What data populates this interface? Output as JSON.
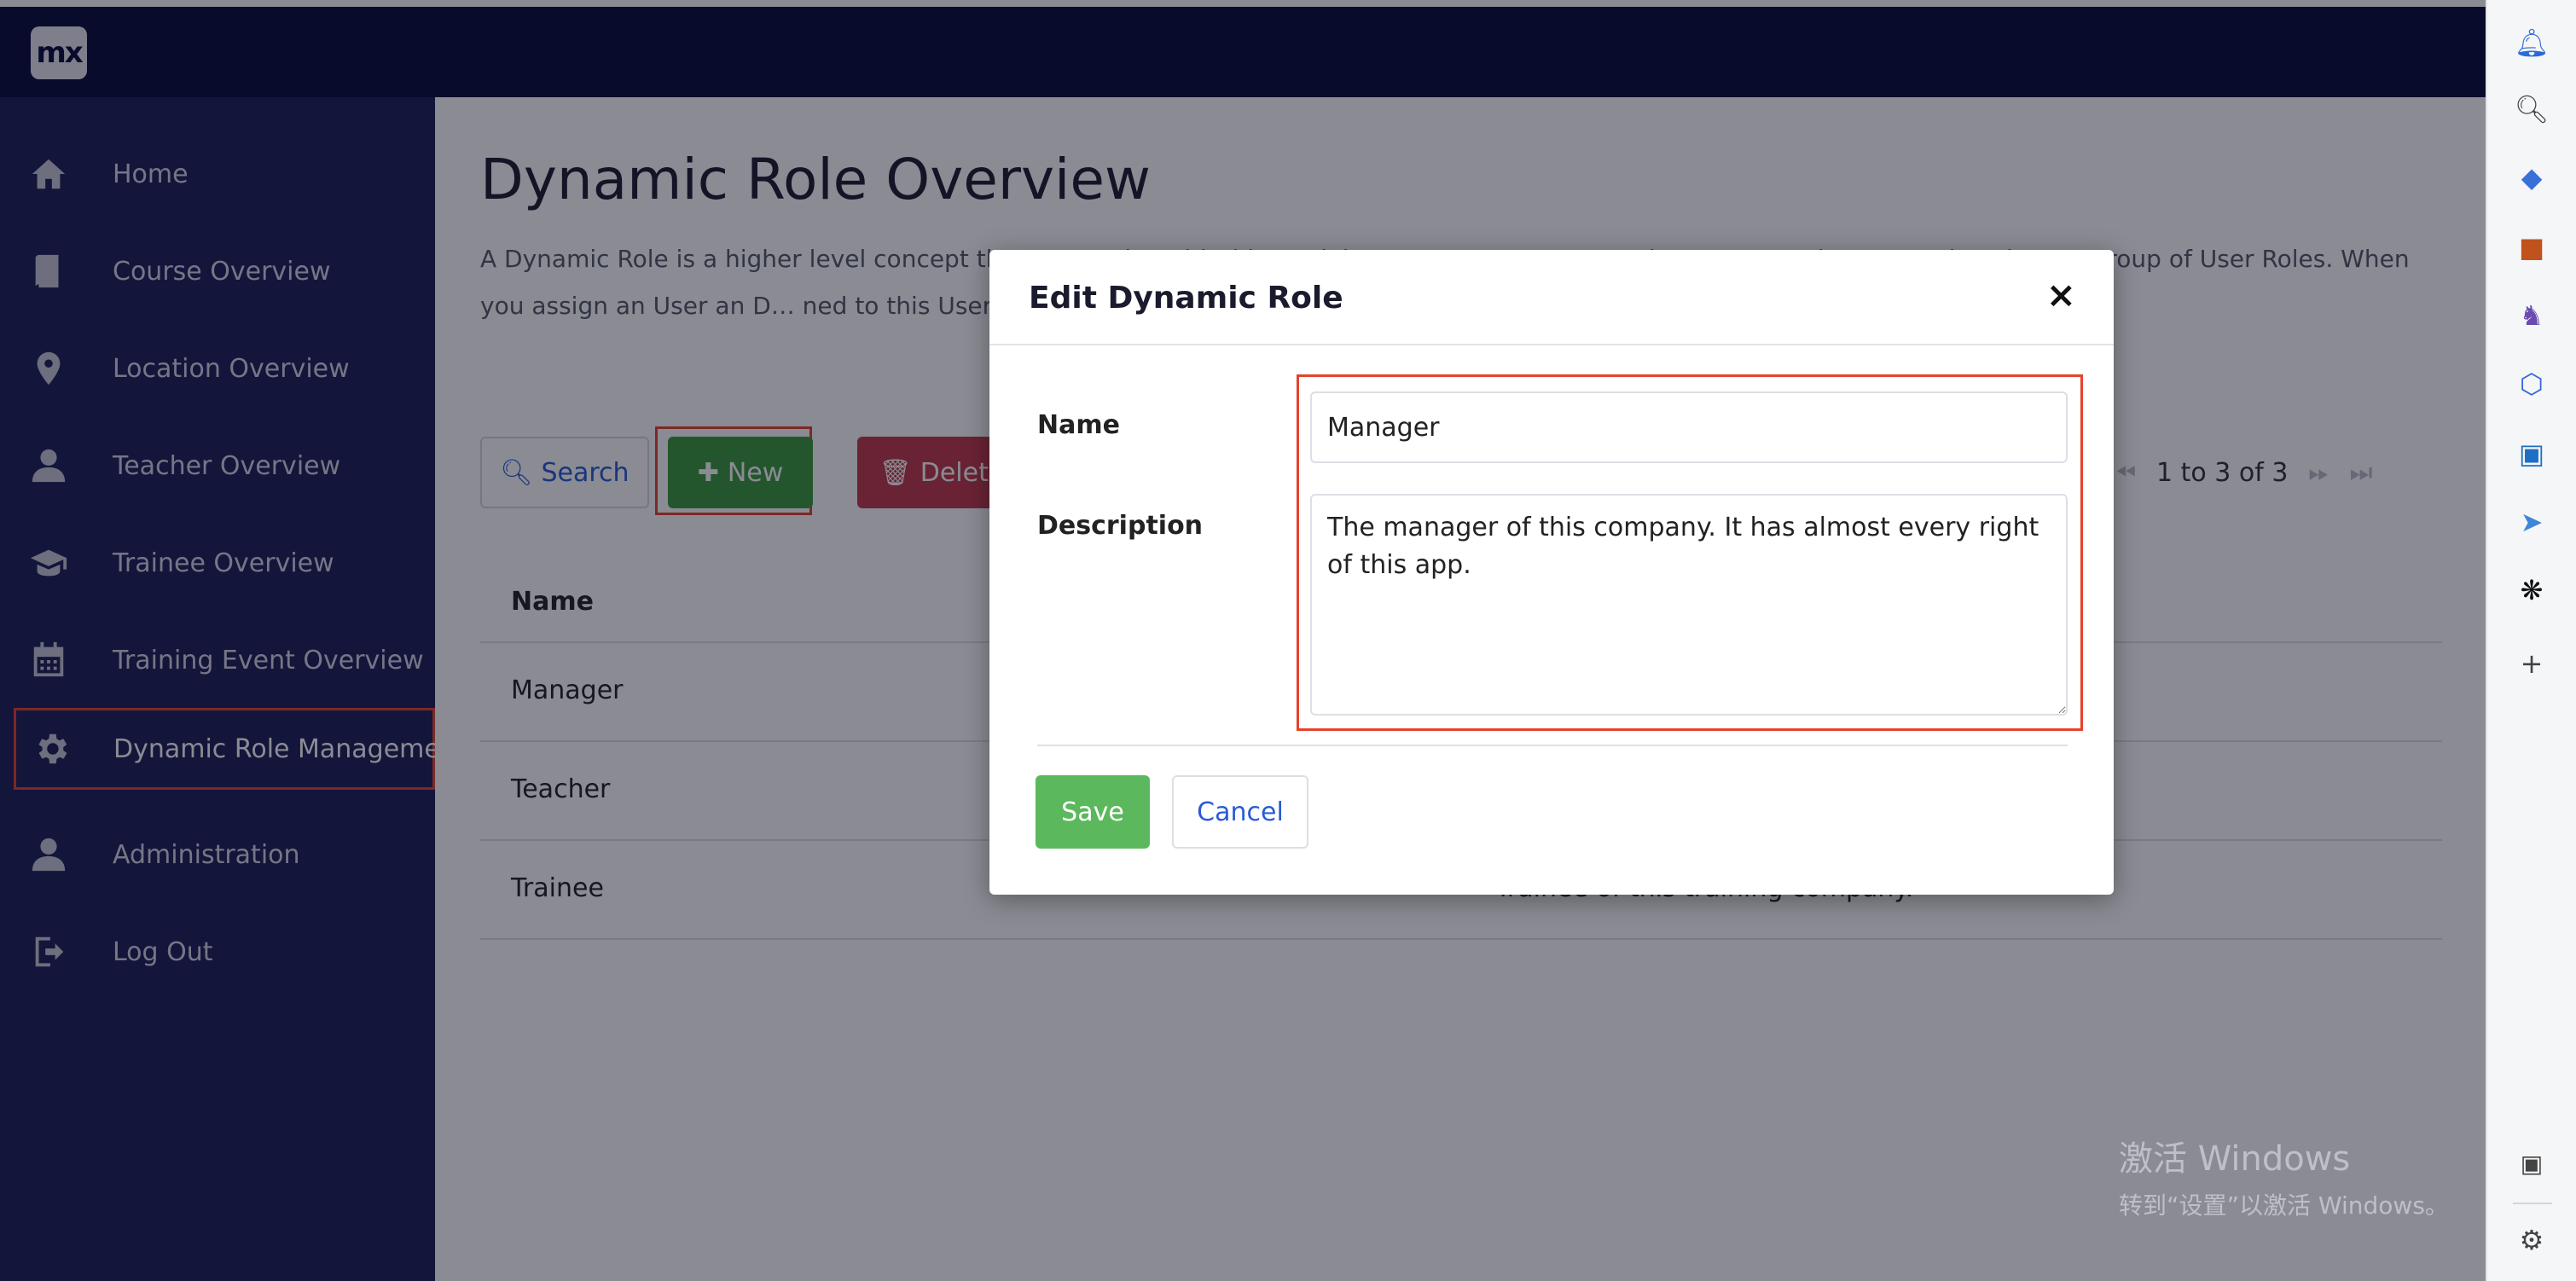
{
  "app": {
    "logo_text": "mx"
  },
  "sidebar": {
    "items": [
      {
        "label": "Home",
        "icon": "home-icon"
      },
      {
        "label": "Course Overview",
        "icon": "book-icon"
      },
      {
        "label": "Location Overview",
        "icon": "map-pin-icon"
      },
      {
        "label": "Teacher Overview",
        "icon": "user-icon"
      },
      {
        "label": "Trainee Overview",
        "icon": "graduation-cap-icon"
      },
      {
        "label": "Training Event Overview",
        "icon": "calendar-icon"
      },
      {
        "label": "Dynamic Role Managemen",
        "icon": "gear-icon",
        "active": true
      },
      {
        "label": "Administration",
        "icon": "user-icon"
      },
      {
        "label": "Log Out",
        "icon": "logout-icon"
      }
    ]
  },
  "main": {
    "title": "Dynamic Role Overview",
    "description": "A Dynamic Role is a higher level concept th… User Role. With this module you can create User Roles... you need to Dynamic Role as a group of User Roles. When you assign an User an D… ned to this User. The assigning action can be done in applicatio… es) which a user has.",
    "toolbar": {
      "search": "Search",
      "new": "New",
      "delete": "Delete"
    },
    "pager": {
      "text": "1 to 3 of 3"
    },
    "grid": {
      "header": "Name",
      "rows": [
        {
          "name": "Manager",
          "description": ""
        },
        {
          "name": "Teacher",
          "description": ""
        },
        {
          "name": "Trainee",
          "description": "Trainee of this training company."
        }
      ]
    }
  },
  "modal": {
    "title": "Edit Dynamic Role",
    "close_label": "×",
    "name_label": "Name",
    "name_value": "Manager",
    "description_label": "Description",
    "description_value": "The manager of this company. It has almost every right of this app.",
    "save": "Save",
    "cancel": "Cancel"
  },
  "rightbar": {
    "icons": [
      "bell-icon",
      "search-icon",
      "tag-icon",
      "briefcase-icon",
      "games-icon",
      "copilot-icon",
      "outlook-icon",
      "send-icon",
      "chatgpt-icon",
      "plus-icon"
    ],
    "plus": "+"
  },
  "watermark": {
    "line1": "激活 Windows",
    "line2": "转到“设置”以激活 Windows。"
  }
}
